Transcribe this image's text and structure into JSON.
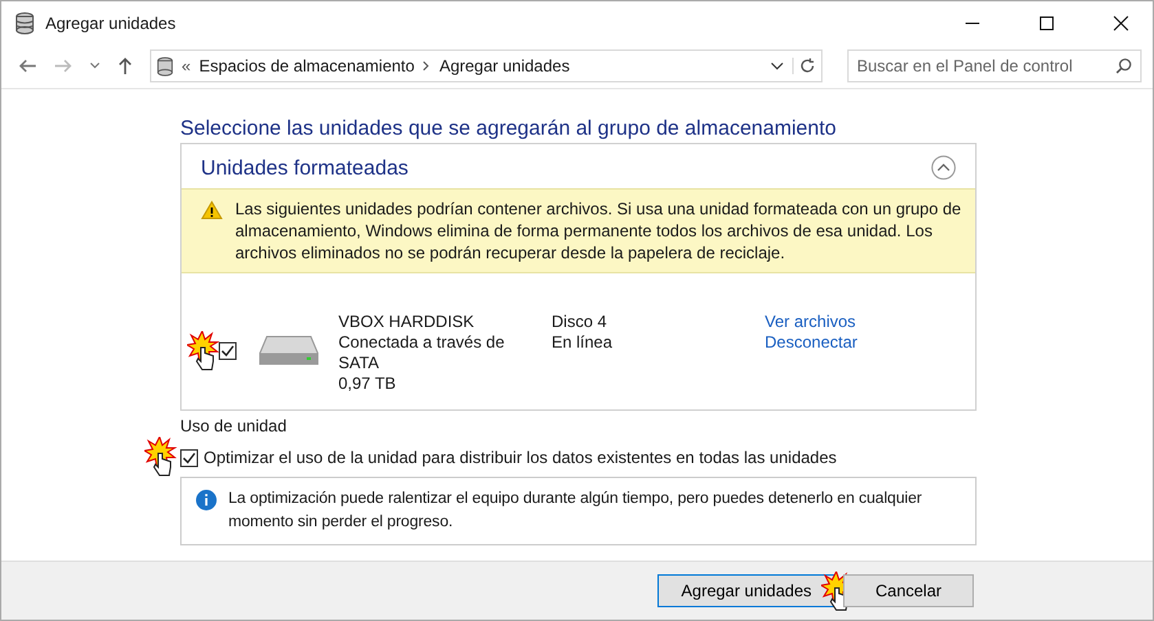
{
  "window": {
    "title": "Agregar unidades"
  },
  "nav": {
    "breadcrumb_overflow": "«",
    "breadcrumb": [
      "Espacios de almacenamiento",
      "Agregar unidades"
    ],
    "search": {
      "placeholder": "Buscar en el Panel de control"
    }
  },
  "heading": "Seleccione las unidades que se agregarán al grupo de almacenamiento",
  "panel": {
    "title": "Unidades formateadas",
    "expanded": true,
    "warning": "Las siguientes unidades podrían contener archivos. Si usa una unidad formateada con un grupo de almacenamiento, Windows elimina de forma permanente todos los archivos de esa unidad. Los archivos eliminados no se podrán recuperar desde la papelera de reciclaje.",
    "drives": [
      {
        "checked": true,
        "name": "VBOX HARDDISK",
        "connection": "Conectada a través de SATA",
        "size": "0,97 TB",
        "disk": "Disco 4",
        "status": "En línea",
        "links": [
          "Ver archivos",
          "Desconectar"
        ]
      }
    ]
  },
  "usage": {
    "label": "Uso de unidad",
    "optimize": {
      "checked": true,
      "label": "Optimizar el uso de la unidad para distribuir los datos existentes en todas las unidades"
    },
    "info": "La optimización puede ralentizar el equipo durante algún tiempo, pero puedes detenerlo en cualquier momento sin perder el progreso."
  },
  "buttons": [
    {
      "label": "Agregar unidades",
      "primary": true
    },
    {
      "label": "Cancelar",
      "primary": false
    }
  ]
}
